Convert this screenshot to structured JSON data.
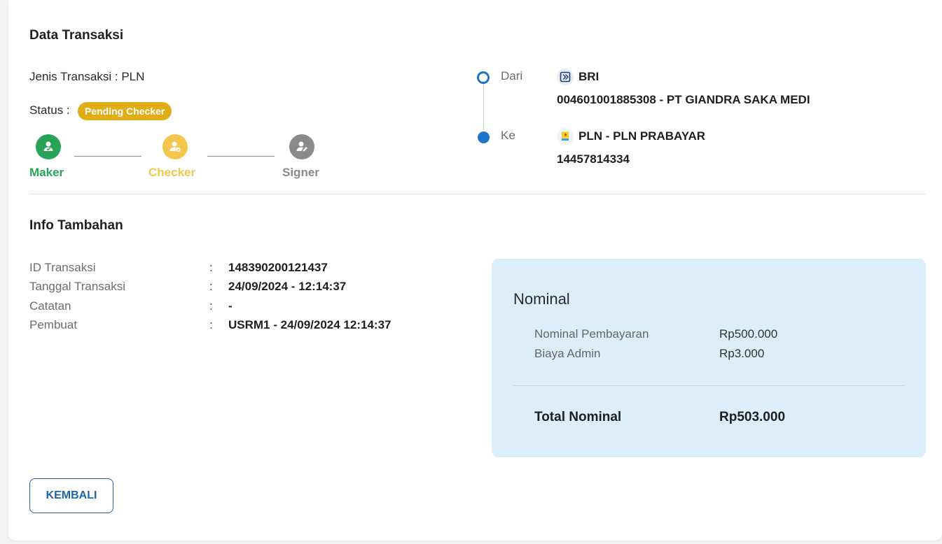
{
  "data_transaksi": {
    "title": "Data Transaksi",
    "jenis_label": "Jenis Transaksi : PLN",
    "status_label": "Status :",
    "status_badge": "Pending Checker",
    "colors": {
      "badge": "#e0ad16",
      "maker": "#2aa35a",
      "checker": "#f2c74b",
      "signer": "#8a8a8a"
    },
    "steps": [
      {
        "label": "Maker",
        "icon": "user-check-icon"
      },
      {
        "label": "Checker",
        "icon": "user-clock-icon"
      },
      {
        "label": "Signer",
        "icon": "user-pen-icon"
      }
    ],
    "dari_label": "Dari",
    "dari_bank": "BRI",
    "dari_bank_icon": "bri-logo-icon",
    "dari_account": "004601001885308 - PT GIANDRA SAKA MEDI",
    "ke_label": "Ke",
    "ke_name": "PLN - PLN PRABAYAR",
    "ke_icon": "pln-logo-icon",
    "ke_account": "14457814334"
  },
  "info_tambahan": {
    "title": "Info Tambahan",
    "rows": [
      {
        "label": "ID Transaksi",
        "colon": ":",
        "value": "148390200121437"
      },
      {
        "label": "Tanggal Transaksi",
        "colon": ":",
        "value": "24/09/2024 - 12:14:37"
      },
      {
        "label": "Catatan",
        "colon": ":",
        "value": "-"
      },
      {
        "label": "Pembuat",
        "colon": ":",
        "value": "USRM1 - 24/09/2024 12:14:37"
      }
    ]
  },
  "nominal": {
    "title": "Nominal",
    "rows": [
      {
        "label": "Nominal Pembayaran",
        "value": "Rp500.000"
      },
      {
        "label": "Biaya Admin",
        "value": "Rp3.000"
      }
    ],
    "total_label": "Total Nominal",
    "total_value": "Rp503.000"
  },
  "actions": {
    "back_label": "KEMBALI"
  }
}
